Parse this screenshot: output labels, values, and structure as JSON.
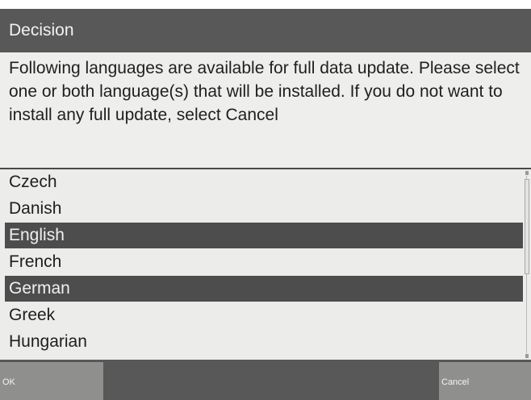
{
  "dialog": {
    "title": "Decision",
    "message": "Following languages are available for full data update. Please select one or both language(s) that will be installed. If you do not want to install any full update, select Cancel"
  },
  "languages": [
    {
      "label": "Czech",
      "selected": false
    },
    {
      "label": "Danish",
      "selected": false
    },
    {
      "label": "English",
      "selected": true
    },
    {
      "label": "French",
      "selected": false
    },
    {
      "label": "German",
      "selected": true
    },
    {
      "label": "Greek",
      "selected": false
    },
    {
      "label": "Hungarian",
      "selected": false
    }
  ],
  "buttons": {
    "ok_label": "OK",
    "cancel_label": "Cancel"
  },
  "colors": {
    "title_bar": "#585858",
    "selection": "#4d4d4d",
    "background": "#ececea",
    "softkey": "#8f8f8d"
  }
}
